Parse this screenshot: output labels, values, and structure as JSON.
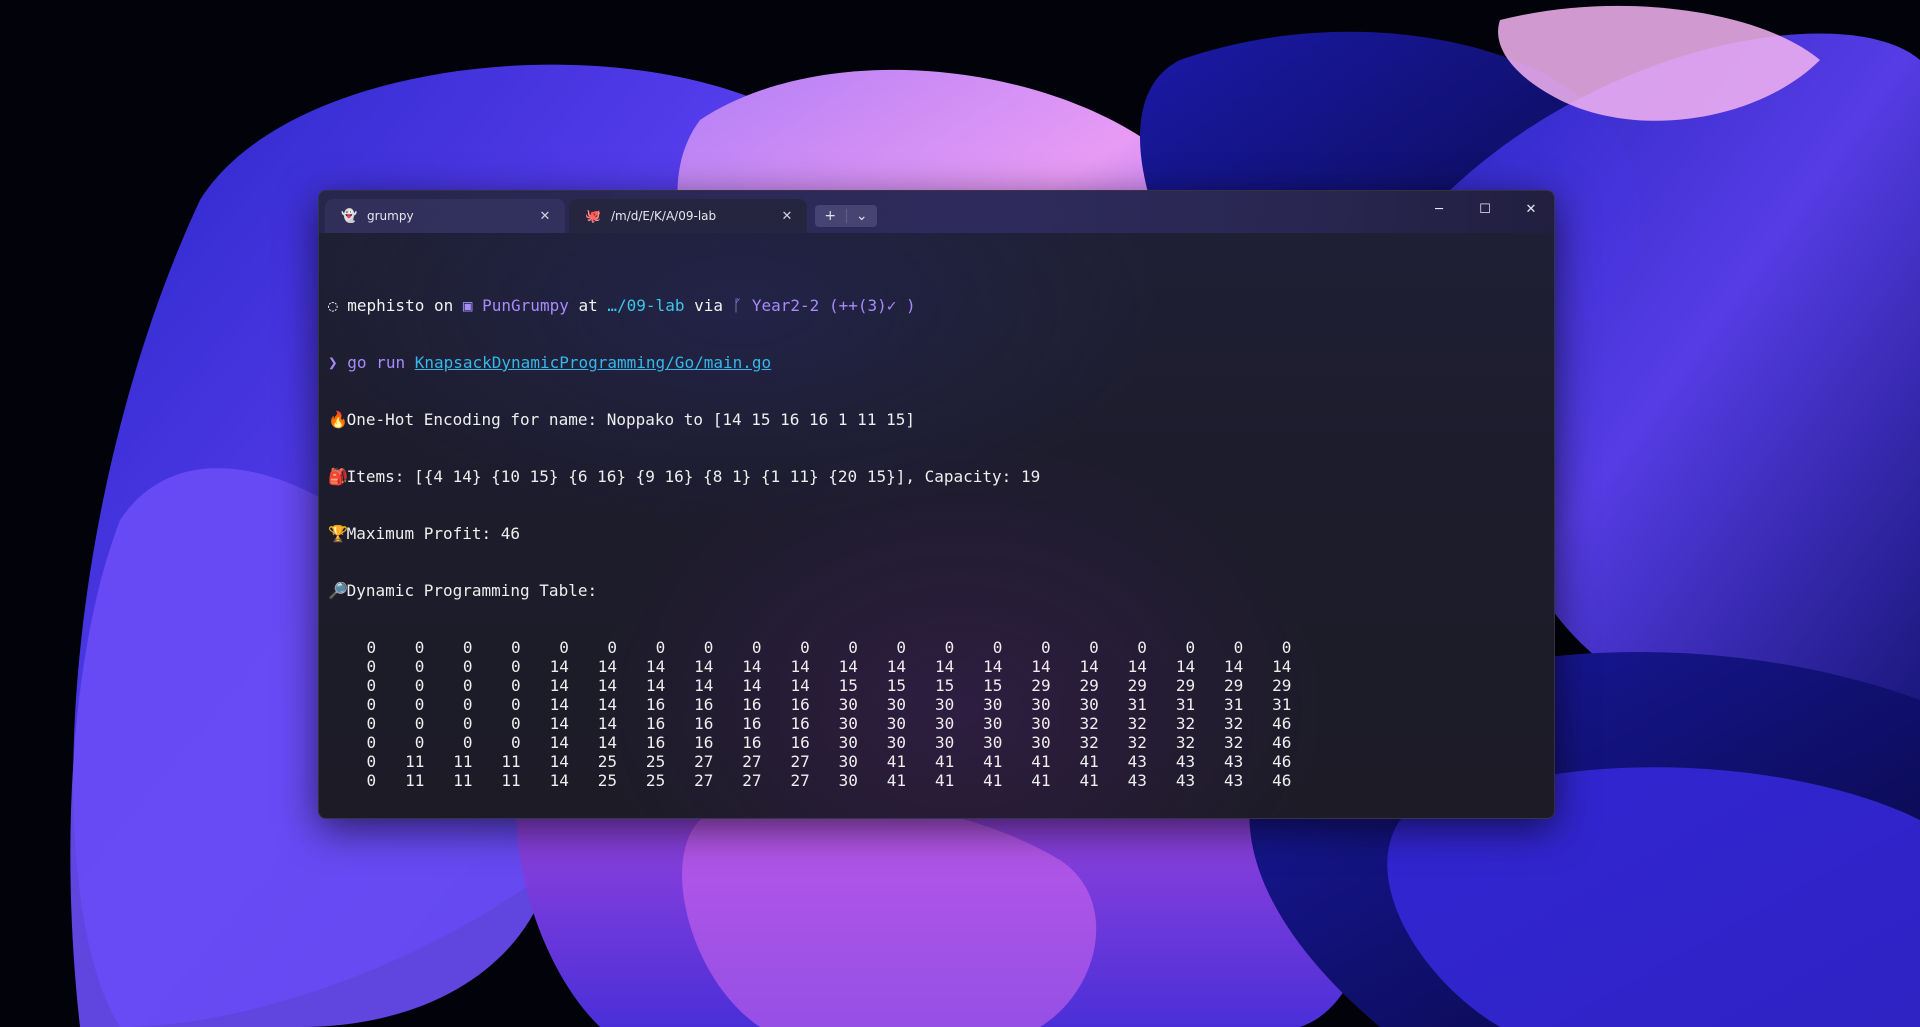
{
  "colors": {
    "prompt_purple": "#a78bfa",
    "path_cyan": "#3dc6e8",
    "link_blue": "#36b7ea",
    "terminal_bg": "#1e1d2e"
  },
  "tabs": [
    {
      "title": "grumpy",
      "icon": "ghost-icon"
    },
    {
      "title": "/m/d/E/K/A/09-lab",
      "icon": "octopus-icon"
    }
  ],
  "tab_actions": {
    "new_tab": "+",
    "dropdown": "⌄"
  },
  "caption": {
    "minimize": "─",
    "maximize": "☐",
    "close": "✕"
  },
  "prompt": {
    "user": "mephisto",
    "on": "on",
    "host": "PunGrumpy",
    "at": "at",
    "path": "…/09-lab",
    "via": "via",
    "branch": "Year2-2",
    "status": "(++(3)✓ )",
    "symbol": "❯"
  },
  "command": {
    "cmd": "go run",
    "arg": "KnapsackDynamicProgramming/Go/main.go"
  },
  "output": {
    "encoding": "One-Hot Encoding for name: Noppako to [14 15 16 16 1 11 15]",
    "items": "Items: [{4 14} {10 15} {6 16} {9 16} {8 1} {1 11} {20 15}], Capacity: 19",
    "profit": "Maximum Profit: 46",
    "table_title": "Dynamic Programming Table:"
  },
  "dp_table": [
    [
      0,
      0,
      0,
      0,
      0,
      0,
      0,
      0,
      0,
      0,
      0,
      0,
      0,
      0,
      0,
      0,
      0,
      0,
      0,
      0
    ],
    [
      0,
      0,
      0,
      0,
      14,
      14,
      14,
      14,
      14,
      14,
      14,
      14,
      14,
      14,
      14,
      14,
      14,
      14,
      14,
      14
    ],
    [
      0,
      0,
      0,
      0,
      14,
      14,
      14,
      14,
      14,
      14,
      15,
      15,
      15,
      15,
      29,
      29,
      29,
      29,
      29,
      29
    ],
    [
      0,
      0,
      0,
      0,
      14,
      14,
      16,
      16,
      16,
      16,
      30,
      30,
      30,
      30,
      30,
      30,
      31,
      31,
      31,
      31
    ],
    [
      0,
      0,
      0,
      0,
      14,
      14,
      16,
      16,
      16,
      16,
      30,
      30,
      30,
      30,
      30,
      32,
      32,
      32,
      32,
      46
    ],
    [
      0,
      0,
      0,
      0,
      14,
      14,
      16,
      16,
      16,
      16,
      30,
      30,
      30,
      30,
      30,
      32,
      32,
      32,
      32,
      46
    ],
    [
      0,
      11,
      11,
      11,
      14,
      25,
      25,
      27,
      27,
      27,
      30,
      41,
      41,
      41,
      41,
      41,
      43,
      43,
      43,
      46
    ],
    [
      0,
      11,
      11,
      11,
      14,
      25,
      25,
      27,
      27,
      27,
      30,
      41,
      41,
      41,
      41,
      41,
      43,
      43,
      43,
      46
    ]
  ]
}
